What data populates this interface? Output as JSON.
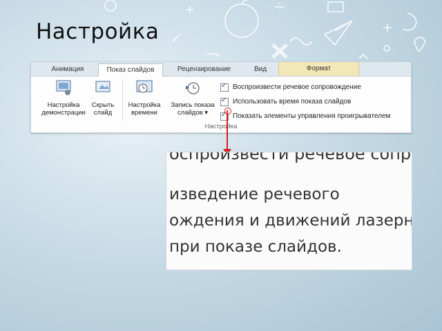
{
  "slide": {
    "title": "Настройка"
  },
  "ribbon": {
    "tabs": [
      {
        "label": "Анимация"
      },
      {
        "label": "Показ слайдов"
      },
      {
        "label": "Рецензирование"
      },
      {
        "label": "Вид"
      },
      {
        "label": "Формат"
      }
    ],
    "buttons": {
      "setup_line1": "Настройка",
      "setup_line2": "демонстрации",
      "hide_line1": "Скрыть",
      "hide_line2": "слайд",
      "timing_line1": "Настройка",
      "timing_line2": "времени",
      "record_line1": "Запись показа",
      "record_line2": "слайдов ▾"
    },
    "checkboxes": [
      {
        "label": "Воспроизвести речевое сопровождение",
        "checked": true
      },
      {
        "label": "Использовать время показа слайдов",
        "checked": true
      },
      {
        "label": "Показать элементы управления проигрывателем",
        "checked": true
      }
    ],
    "group_label": "Настройка"
  },
  "zoom": {
    "top_fragment": "оспроизвести речевое сопровождени",
    "line1": "изведение речевого",
    "line2": "ождения и движений лазерн",
    "line3": "при показе слайдов."
  },
  "colors": {
    "arrow": "#d42020",
    "format_tab": "#f3e7b8"
  }
}
